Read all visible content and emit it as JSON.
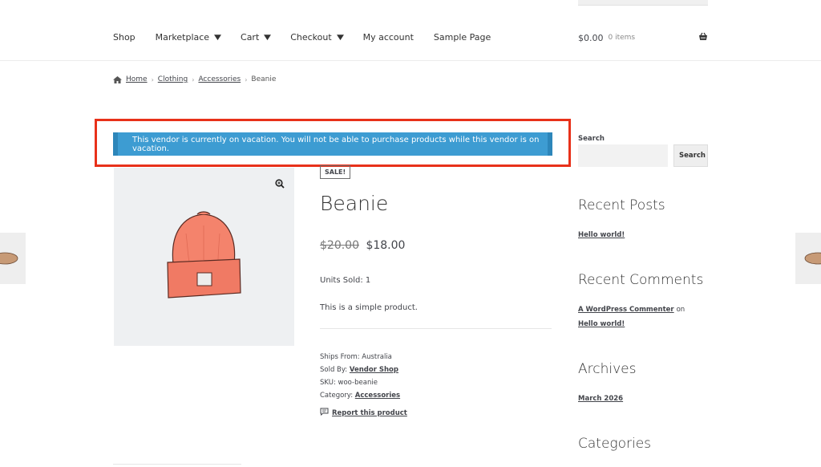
{
  "nav": {
    "items": [
      {
        "label": "Shop",
        "dropdown": false
      },
      {
        "label": "Marketplace",
        "dropdown": true
      },
      {
        "label": "Cart",
        "dropdown": true
      },
      {
        "label": "Checkout",
        "dropdown": true
      },
      {
        "label": "My account",
        "dropdown": false
      },
      {
        "label": "Sample Page",
        "dropdown": false
      }
    ]
  },
  "cart": {
    "total": "$0.00",
    "count": "0 items",
    "icon": "basket-icon"
  },
  "breadcrumb": {
    "home": "Home",
    "clothing": "Clothing",
    "accessories": "Accessories",
    "current": "Beanie",
    "separator": "›"
  },
  "notice": {
    "text": "This vendor is currently on vacation. You will not be able to purchase products while this vendor is on vacation.",
    "color": "#3d9cd2",
    "highlight_color": "#e8311a"
  },
  "product": {
    "sale_badge": "SALE!",
    "title": "Beanie",
    "old_price": "$20.00",
    "price": "$18.00",
    "units_sold": "Units Sold: 1",
    "description": "This is a simple product.",
    "ships_from": "Ships From: Australia",
    "sold_by_label": "Sold By:",
    "vendor": "Vendor Shop",
    "sku": "SKU: woo-beanie",
    "category_label": "Category:",
    "category": "Accessories",
    "report": "Report this product"
  },
  "sidebar": {
    "search_label": "Search",
    "search_placeholder": "",
    "search_button": "Search",
    "recent_posts_title": "Recent Posts",
    "recent_post": "Hello world!",
    "recent_comments_title": "Recent Comments",
    "commenter": "A WordPress Commenter",
    "on": "on",
    "comment_post": "Hello world!",
    "archives_title": "Archives",
    "archive": "March 2026",
    "categories_title": "Categories"
  }
}
